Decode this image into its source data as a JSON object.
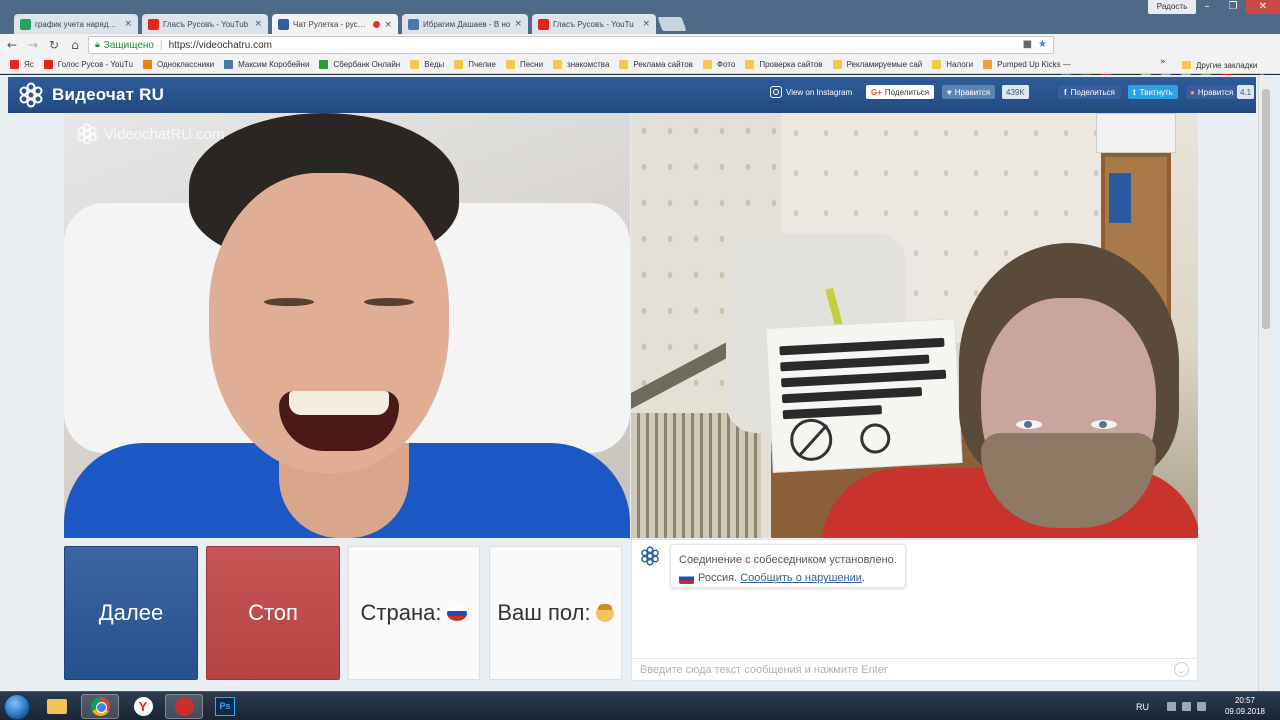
{
  "window": {
    "user_label": "Радость",
    "tabs": [
      {
        "label": "график учета нарядов -",
        "color": "#1fa463"
      },
      {
        "label": "Гласъ Русовъ - YouTub",
        "color": "#e62117"
      },
      {
        "label": "Чат Рулетка - русски",
        "color": "#2f5f9c"
      },
      {
        "label": "Ибрагим Дашаев - В но",
        "color": "#4a76a8"
      },
      {
        "label": "Гласъ Русовъ - YouTu",
        "color": "#e62117"
      }
    ]
  },
  "address_bar": {
    "secure_label": "Защищено",
    "url": "https://videochatru.com"
  },
  "bookmarks": {
    "items": [
      {
        "label": "Яс",
        "color": "#e22"
      },
      {
        "label": "Голос Русов - YouTu",
        "color": "#e62117"
      },
      {
        "label": "Одноклассники",
        "color": "#ee8208"
      },
      {
        "label": "Максим Коробейни",
        "color": "#4a76a8"
      },
      {
        "label": "Сбербанк Онлайн",
        "color": "#21a038"
      },
      {
        "label": "Веды",
        "color": "#f2c94c"
      },
      {
        "label": "Пчелие",
        "color": "#f2c94c"
      },
      {
        "label": "Песни",
        "color": "#f2c94c"
      },
      {
        "label": "знакомства",
        "color": "#f2c94c"
      },
      {
        "label": "Реклама сайтов",
        "color": "#f2c94c"
      },
      {
        "label": "Фото",
        "color": "#f2c94c"
      },
      {
        "label": "Проверка сайтов",
        "color": "#f2c94c"
      },
      {
        "label": "Рекламируемые сай",
        "color": "#f2c94c"
      },
      {
        "label": "Налоги",
        "color": "#f2c94c"
      },
      {
        "label": "Pumped Up Kicks —",
        "color": "#e8a33d"
      }
    ],
    "other": "Другие закладки"
  },
  "site": {
    "brand": "Видеочат RU",
    "watermark": "VideochatRU.com",
    "social": {
      "instagram": "View on Instagram",
      "google_share": "Поделиться",
      "vk_like": "Нравится",
      "vk_count": "439K",
      "facebook": "Поделиться",
      "twitter": "Твитнуть",
      "ok_like": "Нравится",
      "ok_count": "4.1"
    }
  },
  "controls": {
    "next": "Далее",
    "stop": "Стоп",
    "country": "Страна:",
    "gender": "Ваш пол:"
  },
  "chat": {
    "status": "Соединение с собеседником установлено.",
    "country": "Россия.",
    "report": "Сообщить о нарушении",
    "report_suffix": ".",
    "input_placeholder": "Введите сюда текст сообщения и нажмите Enter"
  },
  "taskbar": {
    "lang": "RU",
    "time": "20:57",
    "date": "09.09.2018"
  }
}
